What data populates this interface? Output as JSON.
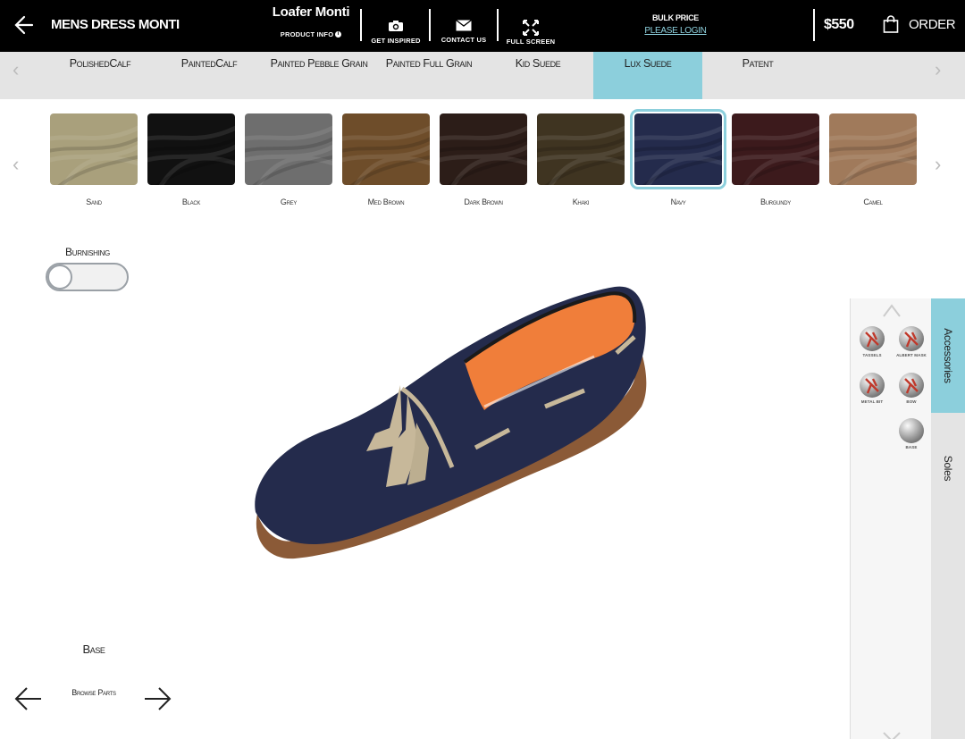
{
  "header": {
    "brand_title": "MENS DRESS MONTI",
    "product_name": "Loafer Monti",
    "product_info_label": "PRODUCT INFO",
    "get_inspired_label": "GET INSPIRED",
    "contact_us_label": "CONTACT US",
    "full_screen_label": "FULL SCREEN",
    "bulk_price_label": "BULK PRICE",
    "bulk_login_link": "PLEASE LOGIN",
    "price": "$550",
    "order_label": "ORDER"
  },
  "materials": {
    "tabs": [
      {
        "label": "PolishedCalf"
      },
      {
        "label": "PaintedCalf"
      },
      {
        "label": "Painted Pebble Grain"
      },
      {
        "label": "Painted Full Grain"
      },
      {
        "label": "Kid Suede"
      },
      {
        "label": "Lux Suede",
        "active": true
      },
      {
        "label": "Patent"
      }
    ]
  },
  "colors": {
    "swatches": [
      {
        "label": "Sand",
        "color": "#a9a07c"
      },
      {
        "label": "Black",
        "color": "#111111"
      },
      {
        "label": "Grey",
        "color": "#6e6e6e"
      },
      {
        "label": "Med Brown",
        "color": "#6e4d2a"
      },
      {
        "label": "Dark Brown",
        "color": "#2c1d18"
      },
      {
        "label": "Khaki",
        "color": "#3f3421"
      },
      {
        "label": "Navy",
        "color": "#242b4c",
        "selected": true
      },
      {
        "label": "Burgundy",
        "color": "#3c1a1c"
      },
      {
        "label": "Camel",
        "color": "#a07a5b"
      }
    ]
  },
  "burnishing": {
    "label": "Burnishing",
    "enabled": false
  },
  "parts": {
    "current_part": "Base",
    "browse_label": "Browse Parts"
  },
  "accessories": {
    "items": [
      {
        "label": "TASSELS"
      },
      {
        "label": "ALBERT MASK"
      },
      {
        "label": "METAL BIT"
      },
      {
        "label": "BOW"
      },
      {
        "label": "BASE"
      }
    ],
    "tabs": [
      {
        "label": "Accessories",
        "active": true
      },
      {
        "label": "Soles"
      }
    ]
  },
  "theme": {
    "accent": "#8ccfdc",
    "header_bg": "#000000",
    "shoe_color": "#242b4c",
    "lining": "#f07e3a",
    "tassel": "#c7b89a"
  }
}
